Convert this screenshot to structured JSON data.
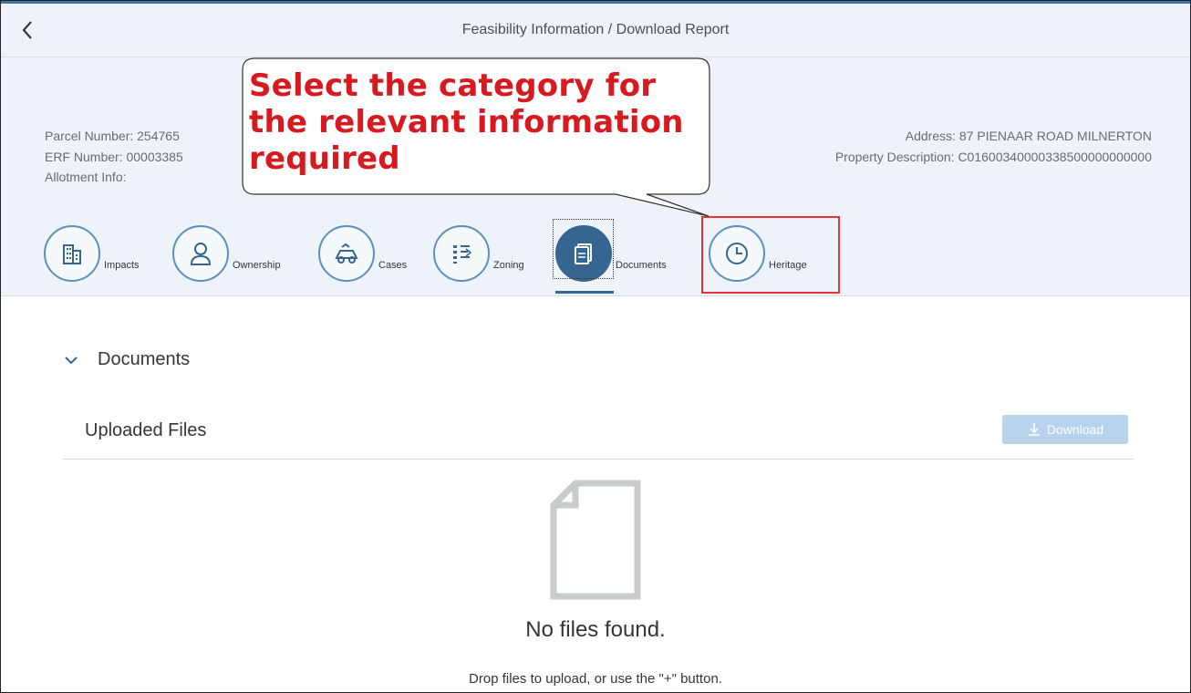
{
  "header": {
    "title": "Feasibility Information / Download Report",
    "back_icon": "chevron-left-icon",
    "parcel_number": "Parcel Number: 254765",
    "erf_number": "ERF Number: 00003385",
    "allotment_info": "Allotment Info:",
    "address": "Address: 87 PIENAAR ROAD MILNERTON",
    "property_description": "Property Description: C01600340000338500000000000"
  },
  "callout": {
    "line1": "Select the category for",
    "line2": "the relevant information",
    "line3": "required"
  },
  "tabs": [
    {
      "label": "Impacts",
      "icon": "building-icon"
    },
    {
      "label": "Ownership",
      "icon": "person-icon"
    },
    {
      "label": "Cases",
      "icon": "cases-icon"
    },
    {
      "label": "Zoning",
      "icon": "zoning-icon"
    },
    {
      "label": "Documents",
      "icon": "documents-icon",
      "active": true
    },
    {
      "label": "Heritage",
      "icon": "clock-icon"
    }
  ],
  "section": {
    "title": "Documents",
    "uploaded_files": "Uploaded Files",
    "download_label": "Download",
    "empty_title": "No files found.",
    "empty_hint": "Drop files to upload, or use the \"+\" button."
  },
  "colors": {
    "accent": "#356692",
    "header_bg": "#edf3f8",
    "callout_text": "#d71920",
    "highlight_box": "#e8303a",
    "download_bg": "#b8d3ec"
  }
}
